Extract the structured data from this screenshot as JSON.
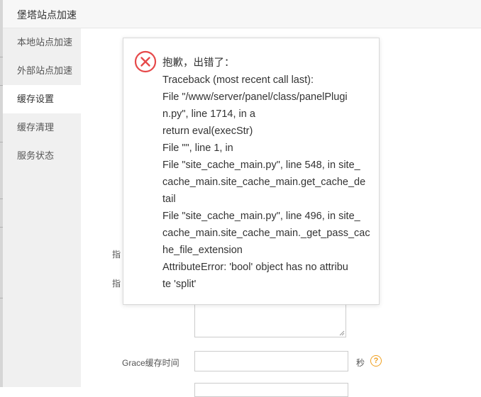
{
  "titlebar": {
    "title": "堡塔站点加速"
  },
  "sidebar": {
    "items": [
      {
        "label": "本地站点加速"
      },
      {
        "label": "外部站点加速"
      },
      {
        "label": "缓存设置"
      },
      {
        "label": "缓存清理"
      },
      {
        "label": "服务状态"
      }
    ],
    "active": "缓存设置"
  },
  "form": {
    "partial_label_1": "指",
    "partial_label_2": "指",
    "grace_label": "Grace缓存时间",
    "grace_value": "",
    "grace_unit": "秒",
    "help_glyph": "?"
  },
  "error_dialog": {
    "icon": "error-circle-x-icon",
    "lines": [
      "抱歉，出错了：",
      "Traceback (most recent call last):",
      "File \"/www/server/panel/class/panelPlugi",
      "n.py\", line 1714, in a",
      "return eval(execStr)",
      "File \"\", line 1, in",
      "File \"site_cache_main.py\", line 548, in site_",
      "cache_main.site_cache_main.get_cache_de",
      "tail",
      "File \"site_cache_main.py\", line 496, in site_",
      "cache_main.site_cache_main._get_pass_cac",
      "he_file_extension",
      "AttributeError: 'bool' object has no attribu",
      "te 'split'"
    ]
  },
  "colors": {
    "error_red": "#e6494a",
    "help_orange": "#f0a020",
    "sidebar_bg": "#f0f0f0"
  }
}
